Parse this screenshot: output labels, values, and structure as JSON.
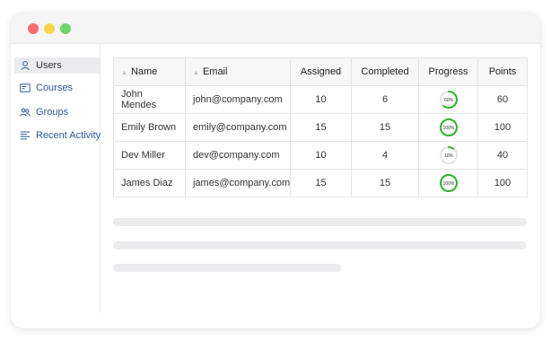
{
  "window": {
    "controls": [
      "close",
      "minimize",
      "maximize"
    ],
    "colors": {
      "close": "#fc6b6b",
      "minimize": "#fbd44b",
      "maximize": "#6dd86a"
    }
  },
  "sidebar": {
    "items": [
      {
        "label": "Users",
        "icon": "user-icon",
        "active": true
      },
      {
        "label": "Courses",
        "icon": "courses-icon",
        "active": false
      },
      {
        "label": "Groups",
        "icon": "groups-icon",
        "active": false
      },
      {
        "label": "Recent Activity",
        "icon": "activity-icon",
        "active": false
      }
    ]
  },
  "table": {
    "columns": [
      "Name",
      "Email",
      "Assigned",
      "Completed",
      "Progress",
      "Points"
    ],
    "rows": [
      {
        "name": "John Mendes",
        "email": "john@company.com",
        "assigned": "10",
        "completed": "6",
        "progress": "60%",
        "progress_value": 0.6,
        "points": "60"
      },
      {
        "name": "Emily Brown",
        "email": "emily@company.com",
        "assigned": "15",
        "completed": "15",
        "progress": "100%",
        "progress_value": 1.0,
        "points": "100"
      },
      {
        "name": "Dev Miller",
        "email": "dev@company.com",
        "assigned": "10",
        "completed": "4",
        "progress": "10%",
        "progress_value": 0.1,
        "points": "40"
      },
      {
        "name": "James Diaz",
        "email": "james@company.com",
        "assigned": "15",
        "completed": "15",
        "progress": "100%",
        "progress_value": 1.0,
        "points": "100"
      }
    ]
  },
  "colors": {
    "progress_ring": "#2fb62a",
    "progress_track": "#e4e4e4",
    "link": "#2c5aa0"
  }
}
